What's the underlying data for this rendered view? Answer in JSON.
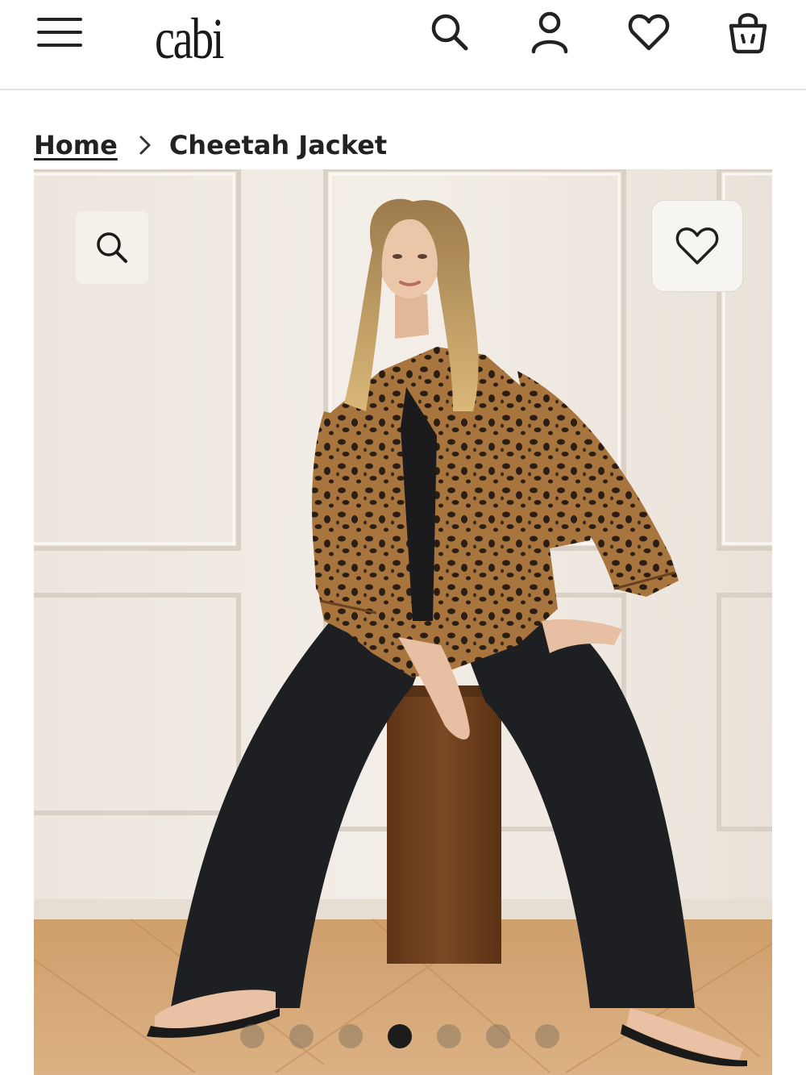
{
  "header": {
    "logo_text": "cabi",
    "menu_icon": "hamburger-menu-icon",
    "search_icon": "search-icon",
    "account_icon": "user-icon",
    "wishlist_icon": "heart-icon",
    "bag_icon": "shopping-bag-icon"
  },
  "breadcrumb": {
    "home": "Home",
    "separator_icon": "chevron-right-icon",
    "current": "Cheetah Jacket"
  },
  "gallery": {
    "zoom_icon": "zoom-search-icon",
    "favorite_icon": "heart-icon",
    "image_count": 7,
    "active_index": 3
  },
  "colors": {
    "accent": "#1c1c1c",
    "divider": "#e2e2e2",
    "inactive_dot": "#9a8e7e"
  }
}
